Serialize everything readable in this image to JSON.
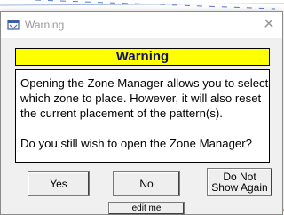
{
  "window": {
    "title": "Warning",
    "icon": "app-window-icon",
    "close_glyph": "✕"
  },
  "banner": {
    "text": "Warning",
    "background": "#ffff00",
    "text_color": "#101070"
  },
  "message": {
    "line1": "Opening the Zone Manager allows you to select which zone to place. However, it will also reset the current placement of the pattern(s).",
    "line2": "Do you still wish to open the Zone Manager?"
  },
  "buttons": {
    "yes": "Yes",
    "no": "No",
    "dont_show_line1": "Do Not",
    "dont_show_line2": "Show Again",
    "edit": "edit me"
  }
}
